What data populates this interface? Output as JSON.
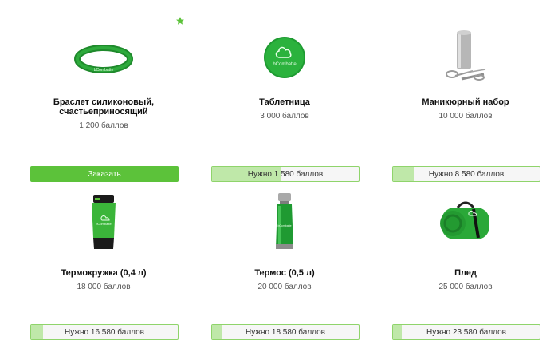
{
  "colors": {
    "accent": "#5cc23a",
    "progress_fill": "#bfe8a9",
    "progress_border": "#8fd46b",
    "star": "#5cc23a"
  },
  "star_icon": "star-icon",
  "products": [
    {
      "title_lines": [
        "Браслет силиконовый,",
        "счастьеприносящий"
      ],
      "price": "1 200 баллов",
      "action": {
        "type": "order",
        "label": "Заказать"
      },
      "icon": "bracelet-image"
    },
    {
      "title_lines": [
        "Таблетница"
      ],
      "price": "3 000 баллов",
      "action": {
        "type": "progress",
        "label": "Нужно 1 580 баллов",
        "progress": 0.47
      },
      "icon": "pillbox-image"
    },
    {
      "title_lines": [
        "Маникюрный набор"
      ],
      "price": "10 000 баллов",
      "action": {
        "type": "progress",
        "label": "Нужно 8 580 баллов",
        "progress": 0.14
      },
      "icon": "manicure-set-image"
    },
    {
      "title_lines": [
        "Термокружка (0,4 л)"
      ],
      "price": "18 000 баллов",
      "action": {
        "type": "progress",
        "label": "Нужно 16 580 баллов",
        "progress": 0.08
      },
      "icon": "thermo-mug-image"
    },
    {
      "title_lines": [
        "Термос (0,5 л)"
      ],
      "price": "20 000 баллов",
      "action": {
        "type": "progress",
        "label": "Нужно 18 580 баллов",
        "progress": 0.07
      },
      "icon": "thermos-image"
    },
    {
      "title_lines": [
        "Плед"
      ],
      "price": "25 000 баллов",
      "action": {
        "type": "progress",
        "label": "Нужно 23 580 баллов",
        "progress": 0.06
      },
      "icon": "blanket-image"
    }
  ]
}
